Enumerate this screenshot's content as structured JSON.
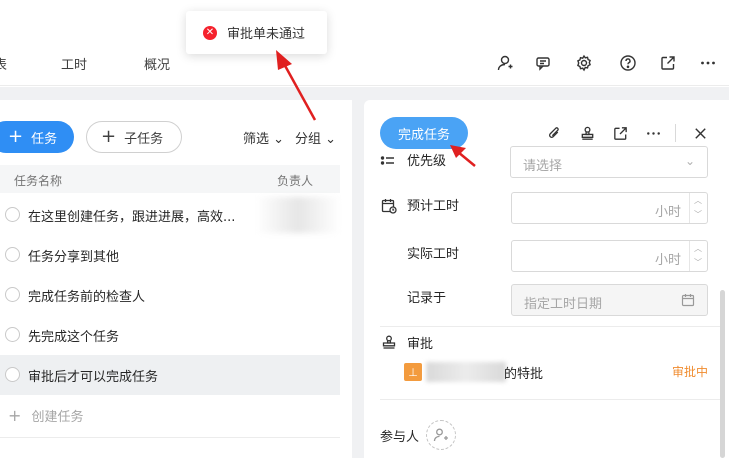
{
  "toast": {
    "icon": "error-x-icon",
    "message": "审批单未通过"
  },
  "nav": {
    "tabs": [
      {
        "label": "表"
      },
      {
        "label": "工时"
      },
      {
        "label": "概况"
      }
    ],
    "icons": [
      "member-icon",
      "chat-icon",
      "settings-gear-icon",
      "help-question-icon",
      "external-link-icon",
      "more-icon"
    ]
  },
  "left": {
    "add_task": "任务",
    "add_subtask": "子任务",
    "filter": "筛选",
    "group": "分组",
    "columns": {
      "name": "任务名称",
      "assignee": "负责人"
    },
    "tasks": [
      {
        "name": "在这里创建任务，跟进进展，高效..."
      },
      {
        "name": "任务分享到其他"
      },
      {
        "name": "完成任务前的检查人"
      },
      {
        "name": "先完成这个任务"
      },
      {
        "name": "审批后才可以完成任务"
      }
    ],
    "create_task": "创建任务"
  },
  "right": {
    "complete_button": "完成任务",
    "priority": {
      "label": "优先级",
      "placeholder": "请选择"
    },
    "estimated": {
      "label": "预计工时",
      "unit": "小时"
    },
    "actual": {
      "label": "实际工时",
      "unit": "小时"
    },
    "record": {
      "label": "记录于",
      "placeholder": "指定工时日期"
    },
    "approval": {
      "label": "审批",
      "name_suffix": "的特批",
      "status": "审批中"
    },
    "participants": {
      "label": "参与人"
    }
  },
  "colors": {
    "primary": "#2f8ef4",
    "error": "#f5222d",
    "warning": "#f08c2f",
    "arrow": "#e02020"
  }
}
